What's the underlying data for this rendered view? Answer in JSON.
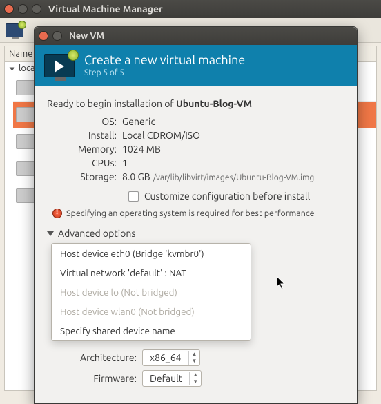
{
  "parent": {
    "title": "Virtual Machine Manager",
    "list_header": "Name",
    "tree_root": "localhost (QEMU)"
  },
  "dialog": {
    "window_title": "New VM",
    "header_title": "Create a new virtual machine",
    "header_step": "Step 5 of 5",
    "ready_prefix": "Ready to begin installation of ",
    "ready_vmname": "Ubuntu-Blog-VM",
    "rows": {
      "os_label": "OS:",
      "os_value": "Generic",
      "install_label": "Install:",
      "install_value": "Local CDROM/ISO",
      "memory_label": "Memory:",
      "memory_value": "1024 MB",
      "cpus_label": "CPUs:",
      "cpus_value": "1",
      "storage_label": "Storage:",
      "storage_value": "8.0 GB",
      "storage_path": "/var/lib/libvirt/images/Ubuntu-Blog-VM.img"
    },
    "customize_label": "Customize configuration before install",
    "warning_text": "Specifying an operating system is required for best performance",
    "advanced_label": "Advanced options",
    "network_options": [
      {
        "label": "Host device eth0 (Bridge 'kvmbr0')",
        "disabled": false
      },
      {
        "label": "Virtual network 'default' : NAT",
        "disabled": false
      },
      {
        "label": "Host device lo (Not bridged)",
        "disabled": true
      },
      {
        "label": "Host device wlan0 (Not bridged)",
        "disabled": true
      },
      {
        "label": "Specify shared device name",
        "disabled": false
      }
    ],
    "arch_label": "Architecture:",
    "arch_value": "x86_64",
    "firmware_label": "Firmware:",
    "firmware_value": "Default"
  }
}
